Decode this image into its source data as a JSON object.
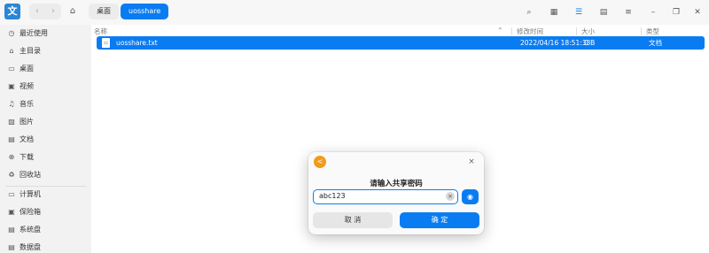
{
  "titlebar": {
    "app_icon": "file-manager-icon",
    "back_glyph": "‹",
    "forward_glyph": "›",
    "home_glyph": "⌂",
    "breadcrumbs": [
      "桌面",
      "uosshare"
    ],
    "icons": {
      "search": "⌕",
      "grid_view": "▦",
      "list_view": "☰",
      "detail_view": "▤",
      "menu": "≡",
      "minimize": "–",
      "maximize": "❐",
      "close": "✕"
    }
  },
  "sidebar": {
    "items": [
      {
        "label": "最近使用",
        "glyph": "◷"
      },
      {
        "label": "主目录",
        "glyph": "⌂"
      },
      {
        "label": "桌面",
        "glyph": "▭"
      },
      {
        "label": "视频",
        "glyph": "▣"
      },
      {
        "label": "音乐",
        "glyph": "♫"
      },
      {
        "label": "图片",
        "glyph": "▨"
      },
      {
        "label": "文档",
        "glyph": "▤"
      },
      {
        "label": "下载",
        "glyph": "⊕"
      },
      {
        "label": "回收站",
        "glyph": "♻"
      },
      {
        "label": "计算机",
        "glyph": "▭"
      },
      {
        "label": "保险箱",
        "glyph": "▣"
      },
      {
        "label": "系统盘",
        "glyph": "▤"
      },
      {
        "label": "数据盘",
        "glyph": "▤"
      }
    ]
  },
  "list": {
    "columns": [
      "名称",
      "修改时间",
      "大小",
      "类型"
    ],
    "sort_glyph": "⌃",
    "rows": [
      {
        "name": "uosshare.txt",
        "modified": "2022/04/16 18:51:33",
        "size": "0 B",
        "type": "文档",
        "selected": true
      }
    ]
  },
  "dialog": {
    "share_glyph": "<",
    "close_glyph": "×",
    "title": "请输入共享密码",
    "password_value": "abc123",
    "clear_glyph": "×",
    "eye_glyph": "◉",
    "cancel_label": "取 消",
    "ok_label": "确 定"
  },
  "colors": {
    "accent": "#0a7cf2",
    "share_badge": "#f39a1b"
  }
}
